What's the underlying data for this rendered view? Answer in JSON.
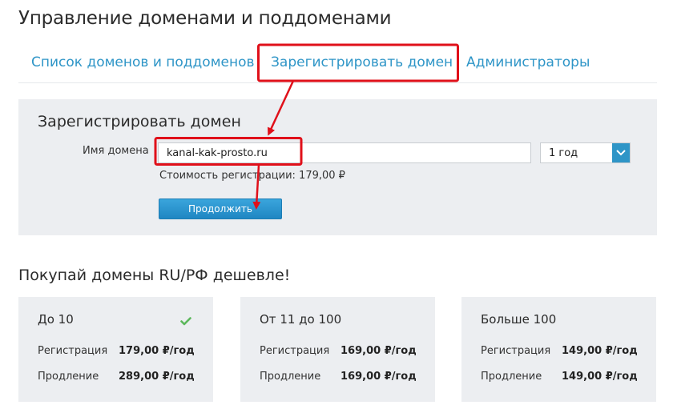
{
  "header": {
    "title": "Управление доменами и поддоменами"
  },
  "tabs": [
    {
      "label": "Список доменов и поддоменов"
    },
    {
      "label": "Зарегистрировать домен"
    },
    {
      "label": "Администраторы"
    }
  ],
  "register_form": {
    "title": "Зарегистрировать домен",
    "domain_label": "Имя домена",
    "domain_value": "kanal-kak-prosto.ru",
    "period_selected": "1 год",
    "cost_text": "Стоимость регистрации: 179,00 ₽",
    "continue_label": "Продолжить"
  },
  "promo": {
    "title": "Покупай домены RU/РФ дешевле!",
    "tiers": [
      {
        "name": "До 10",
        "reg_label": "Регистрация",
        "reg_price": "179,00 ₽/год",
        "renew_label": "Продление",
        "renew_price": "289,00 ₽/год",
        "selected": true
      },
      {
        "name": "От 11 до 100",
        "reg_label": "Регистрация",
        "reg_price": "169,00 ₽/год",
        "renew_label": "Продление",
        "renew_price": "169,00 ₽/год",
        "selected": false
      },
      {
        "name": "Больше 100",
        "reg_label": "Регистрация",
        "reg_price": "149,00 ₽/год",
        "renew_label": "Продление",
        "renew_price": "149,00 ₽/год",
        "selected": false
      }
    ]
  },
  "colors": {
    "accent": "#2e95c7",
    "panel": "#eceef1",
    "annotation": "#e0101a",
    "check": "#5cb85c"
  },
  "icons": [
    "chevron-down-icon",
    "check-icon"
  ]
}
